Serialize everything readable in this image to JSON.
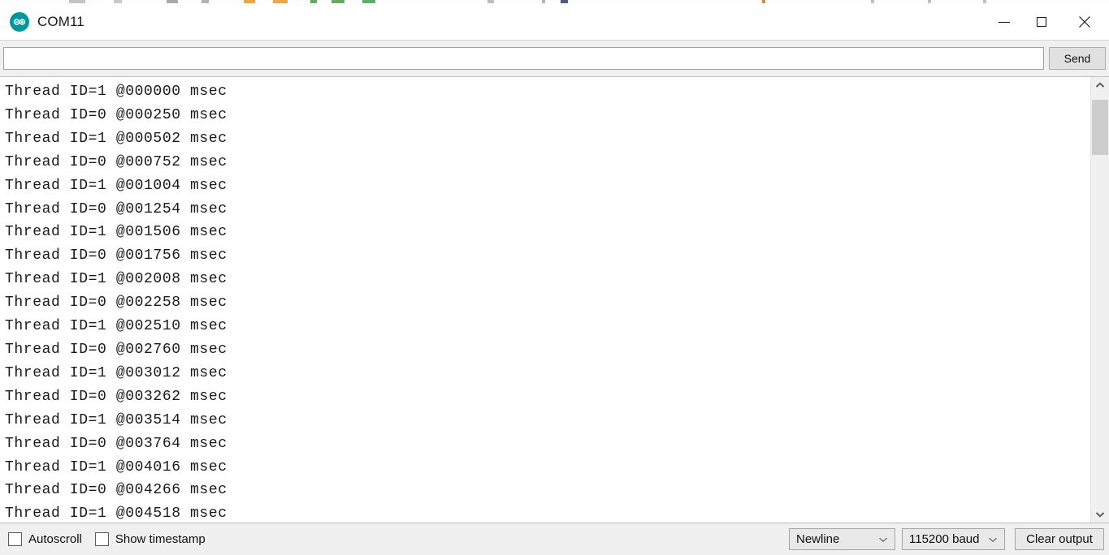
{
  "window": {
    "title": "COM11",
    "app_icon": "arduino-logo-icon",
    "controls": {
      "minimize": "minimize-icon",
      "maximize": "maximize-icon",
      "close": "close-icon"
    }
  },
  "send_row": {
    "input_value": "",
    "input_placeholder": "",
    "send_label": "Send"
  },
  "console": {
    "lines": [
      "Thread ID=1 @000000 msec",
      "Thread ID=0 @000250 msec",
      "Thread ID=1 @000502 msec",
      "Thread ID=0 @000752 msec",
      "Thread ID=1 @001004 msec",
      "Thread ID=0 @001254 msec",
      "Thread ID=1 @001506 msec",
      "Thread ID=0 @001756 msec",
      "Thread ID=1 @002008 msec",
      "Thread ID=0 @002258 msec",
      "Thread ID=1 @002510 msec",
      "Thread ID=0 @002760 msec",
      "Thread ID=1 @003012 msec",
      "Thread ID=0 @003262 msec",
      "Thread ID=1 @003514 msec",
      "Thread ID=0 @003764 msec",
      "Thread ID=1 @004016 msec",
      "Thread ID=0 @004266 msec",
      "Thread ID=1 @004518 msec"
    ]
  },
  "scrollbar": {
    "up_icon": "chevron-up-icon",
    "down_icon": "chevron-down-icon"
  },
  "statusbar": {
    "autoscroll_label": "Autoscroll",
    "autoscroll_checked": false,
    "show_timestamp_label": "Show timestamp",
    "show_timestamp_checked": false,
    "line_ending": "Newline",
    "baud_rate": "115200 baud",
    "clear_label": "Clear output"
  },
  "colors": {
    "accent": "#00979c",
    "titlebar_bg": "#ffffff",
    "toolbar_bg": "#f0f0f0",
    "console_bg": "#ffffff",
    "console_text": "#1a1a1a",
    "scrollbar_thumb": "#cdcdcd"
  }
}
